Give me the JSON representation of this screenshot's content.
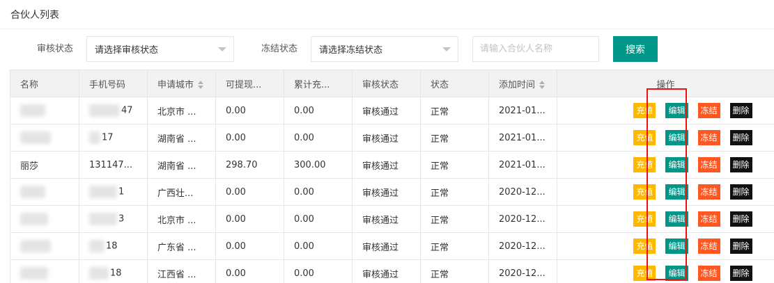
{
  "page": {
    "title": "合伙人列表"
  },
  "filters": {
    "audit_label": "审核状态",
    "audit_select_value": "请选择审核状态",
    "freeze_label": "冻结状态",
    "freeze_select_value": "请选择冻结状态",
    "name_input_placeholder": "请输入合伙人名称",
    "search_label": "搜索"
  },
  "table": {
    "headers": {
      "name": "名称",
      "phone": "手机号码",
      "city": "申请城市",
      "withdrawable": "可提现...",
      "total_recharge": "累计充...",
      "audit_status": "审核状态",
      "status": "状态",
      "added_time": "添加时间",
      "actions": "操作"
    },
    "action_labels": {
      "recharge": "充值",
      "edit": "编辑",
      "freeze": "冻结",
      "delete": "删除"
    },
    "rows": [
      {
        "name": "",
        "phone": "47",
        "city": "北京市 ...",
        "withdrawable": "0.00",
        "total_recharge": "0.00",
        "audit_status": "审核通过",
        "status": "正常",
        "added_time": "2021-01..."
      },
      {
        "name": "",
        "phone": "17",
        "city": "湖南省 ...",
        "withdrawable": "0.00",
        "total_recharge": "0.00",
        "audit_status": "审核通过",
        "status": "正常",
        "added_time": "2021-01..."
      },
      {
        "name": "丽莎",
        "phone": "131147...",
        "city": "湖南省 ...",
        "withdrawable": "298.70",
        "total_recharge": "300.00",
        "audit_status": "审核通过",
        "status": "正常",
        "added_time": "2021-01..."
      },
      {
        "name": "",
        "phone": "1",
        "city": "广西壮...",
        "withdrawable": "0.00",
        "total_recharge": "0.00",
        "audit_status": "审核通过",
        "status": "正常",
        "added_time": "2020-12..."
      },
      {
        "name": "",
        "phone": "3",
        "city": "北京市 ...",
        "withdrawable": "0.00",
        "total_recharge": "0.00",
        "audit_status": "审核通过",
        "status": "正常",
        "added_time": "2020-12..."
      },
      {
        "name": "",
        "phone": "18",
        "city": "广东省 ...",
        "withdrawable": "0.00",
        "total_recharge": "0.00",
        "audit_status": "审核通过",
        "status": "正常",
        "added_time": "2020-12..."
      },
      {
        "name": "",
        "phone": "18",
        "city": "江西省 ...",
        "withdrawable": "0.00",
        "total_recharge": "0.00",
        "audit_status": "审核通过",
        "status": "正常",
        "added_time": "2020-12..."
      }
    ]
  },
  "colors": {
    "primary": "#009688",
    "recharge": "#ffb800",
    "freeze": "#ff5722",
    "delete": "#111111",
    "highlight": "#ee1111"
  }
}
